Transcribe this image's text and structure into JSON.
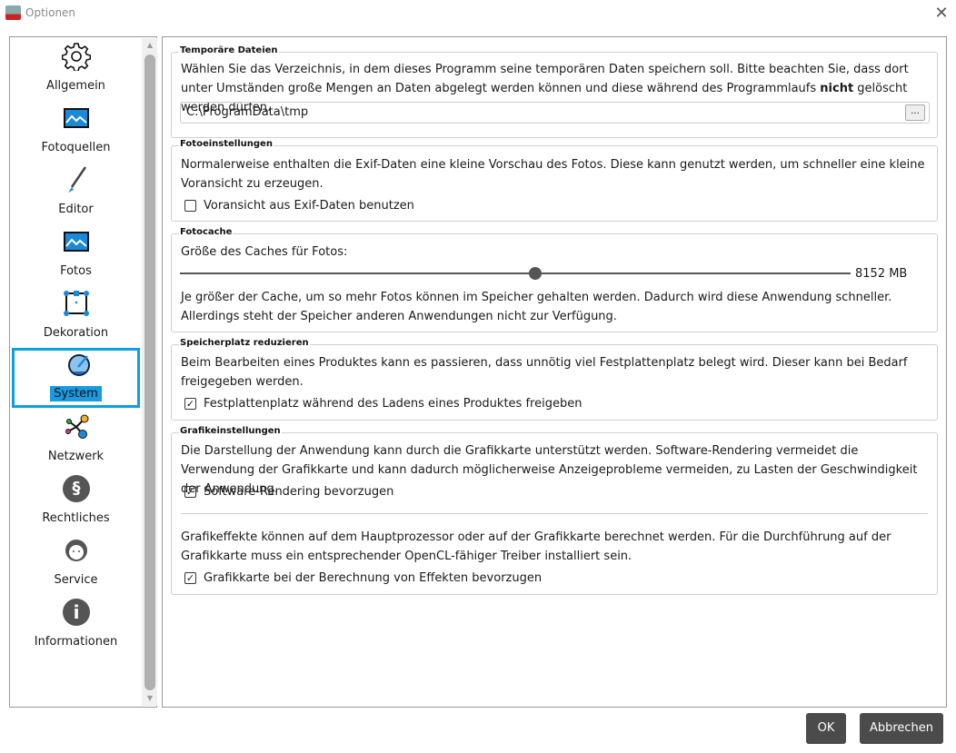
{
  "window": {
    "title": "Optionen",
    "close": "✕"
  },
  "sidebar": {
    "items": [
      {
        "label": "Allgemein",
        "icon": "gear-icon"
      },
      {
        "label": "Fotoquellen",
        "icon": "image-icon"
      },
      {
        "label": "Editor",
        "icon": "brush-icon"
      },
      {
        "label": "Fotos",
        "icon": "image-icon"
      },
      {
        "label": "Dekoration",
        "icon": "frame-icon"
      },
      {
        "label": "System",
        "icon": "gauge-icon",
        "selected": true
      },
      {
        "label": "Netzwerk",
        "icon": "network-icon"
      },
      {
        "label": "Rechtliches",
        "icon": "paragraph-icon"
      },
      {
        "label": "Service",
        "icon": "headset-icon"
      },
      {
        "label": "Informationen",
        "icon": "info-icon"
      }
    ]
  },
  "temp": {
    "legend": "Temporäre Dateien",
    "text_a": "Wählen Sie das Verzeichnis, in dem dieses Programm seine temporären Daten speichern soll. Bitte beachten Sie, dass dort unter Umständen große Mengen an Daten abgelegt werden können und diese während des Programmlaufs ",
    "text_bold": "nicht",
    "text_b": " gelöscht werden dürfen.",
    "path": "C:\\ProgramData\\tmp",
    "browse": "..."
  },
  "photo": {
    "legend": "Fotoeinstellungen",
    "text": "Normalerweise enthalten die Exif-Daten eine kleine Vorschau des Fotos. Diese kann genutzt werden, um schneller eine kleine Voransicht zu erzeugen.",
    "checkbox": "Voransicht aus Exif-Daten benutzen",
    "checked": false
  },
  "cache": {
    "legend": "Fotocache",
    "label": "Größe des Caches für Fotos:",
    "value": "8152 MB",
    "slider_fraction": 0.53,
    "text": "Je größer der Cache, um so mehr Fotos können im Speicher gehalten werden. Dadurch wird diese Anwendung schneller. Allerdings steht der Speicher anderen Anwendungen nicht zur Verfügung."
  },
  "disk": {
    "legend": "Speicherplatz reduzieren",
    "text": "Beim Bearbeiten eines Produktes kann es passieren, dass unnötig viel Festplattenplatz belegt wird. Dieser kann bei Bedarf freigegeben werden.",
    "checkbox": "Festplattenplatz während des Ladens eines Produktes freigeben",
    "checked": true
  },
  "graphics": {
    "legend": "Grafikeinstellungen",
    "text1": "Die Darstellung der Anwendung kann durch die Grafikkarte unterstützt werden. Software-Rendering vermeidet die Verwendung der Grafikkarte und kann dadurch möglicherweise Anzeigeprobleme vermeiden, zu Lasten der Geschwindigkeit der Anwendung.",
    "checkbox1": "Software-Rendering bevorzugen",
    "checked1": true,
    "text2": "Grafikeffekte können auf dem Hauptprozessor oder auf der Grafikkarte berechnet werden. Für die Durchführung auf der Grafikkarte muss ein entsprechender OpenCL-fähiger Treiber installiert sein.",
    "checkbox2": "Grafikkarte bei der Berechnung von Effekten bevorzugen",
    "checked2": true
  },
  "buttons": {
    "ok": "OK",
    "cancel": "Abbrechen"
  },
  "colors": {
    "accent": "#0aa0e0",
    "button": "#4b4b4b"
  }
}
